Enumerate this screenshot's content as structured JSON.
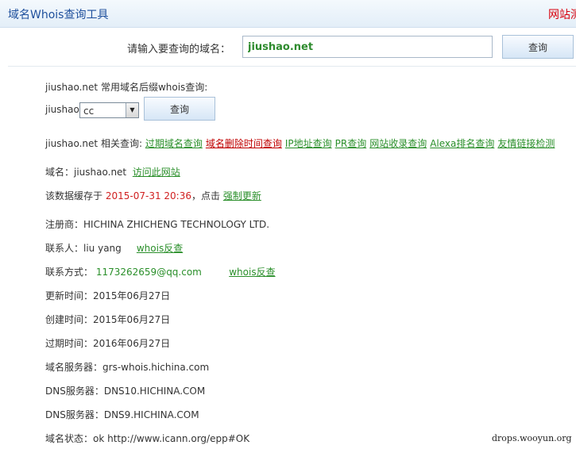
{
  "header": {
    "title": "域名Whois查询工具",
    "right_link": "网站测"
  },
  "search": {
    "label": "请输入要查询的域名：",
    "value": "jiushao.net",
    "button": "查询"
  },
  "suffix": {
    "heading": "jiushao.net 常用域名后缀whois查询:",
    "prefix": "jiushao.",
    "selected": "cc",
    "button": "查询"
  },
  "related": {
    "label": "jiushao.net 相关查询:",
    "links": [
      "过期域名查询",
      "域名删除时间查询",
      "IP地址查询",
      "PR查询",
      "网站收录查询",
      "Alexa排名查询",
      "友情链接检测"
    ]
  },
  "domain": {
    "label": "域名：",
    "value": "jiushao.net",
    "visit_link": "访问此网站"
  },
  "cache": {
    "text_before": "该数据缓存于",
    "date": "2015-07-31 20:36",
    "text_after": "，点击",
    "refresh_link": "强制更新"
  },
  "info": {
    "registrar_label": "注册商：",
    "registrar": "HICHINA ZHICHENG TECHNOLOGY LTD.",
    "contact_label": "联系人：",
    "contact": "liu yang",
    "contact_whois": "whois反查",
    "method_label": "联系方式：",
    "email": "1173262659@qq.com",
    "email_whois": "whois反查",
    "updated_label": "更新时间：",
    "updated": "2015年06月27日",
    "created_label": "创建时间：",
    "created": "2015年06月27日",
    "expires_label": "过期时间：",
    "expires": "2016年06月27日",
    "whois_server_label": "域名服务器：",
    "whois_server": "grs-whois.hichina.com",
    "dns1_label": "DNS服务器：",
    "dns1": "DNS10.HICHINA.COM",
    "dns2_label": "DNS服务器：",
    "dns2": "DNS9.HICHINA.COM",
    "status_label": "域名状态：",
    "status": "ok http://www.icann.org/epp#OK"
  },
  "watermark": "drops.wooyun.org",
  "colors": {
    "link_green": "#2a8f2a",
    "link_red": "#c00000",
    "date_red": "#d02020",
    "title_blue": "#1e4f9c"
  }
}
